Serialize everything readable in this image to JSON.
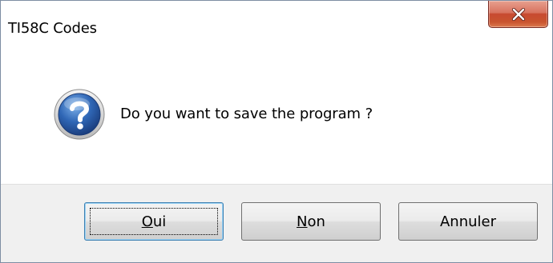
{
  "window": {
    "title": "TI58C Codes"
  },
  "titlebar": {
    "close_icon": "close-icon"
  },
  "dialog": {
    "icon": "question-icon",
    "message": "Do you want to save the program ?"
  },
  "buttons": {
    "yes": {
      "mnemonic": "O",
      "rest": "ui"
    },
    "no": {
      "mnemonic": "N",
      "rest": "on"
    },
    "cancel": {
      "label": "Annuler"
    }
  },
  "colors": {
    "close_button": "#c9542f",
    "icon_blue": "#2a5ea8",
    "focus_border": "#3c7fb1"
  }
}
